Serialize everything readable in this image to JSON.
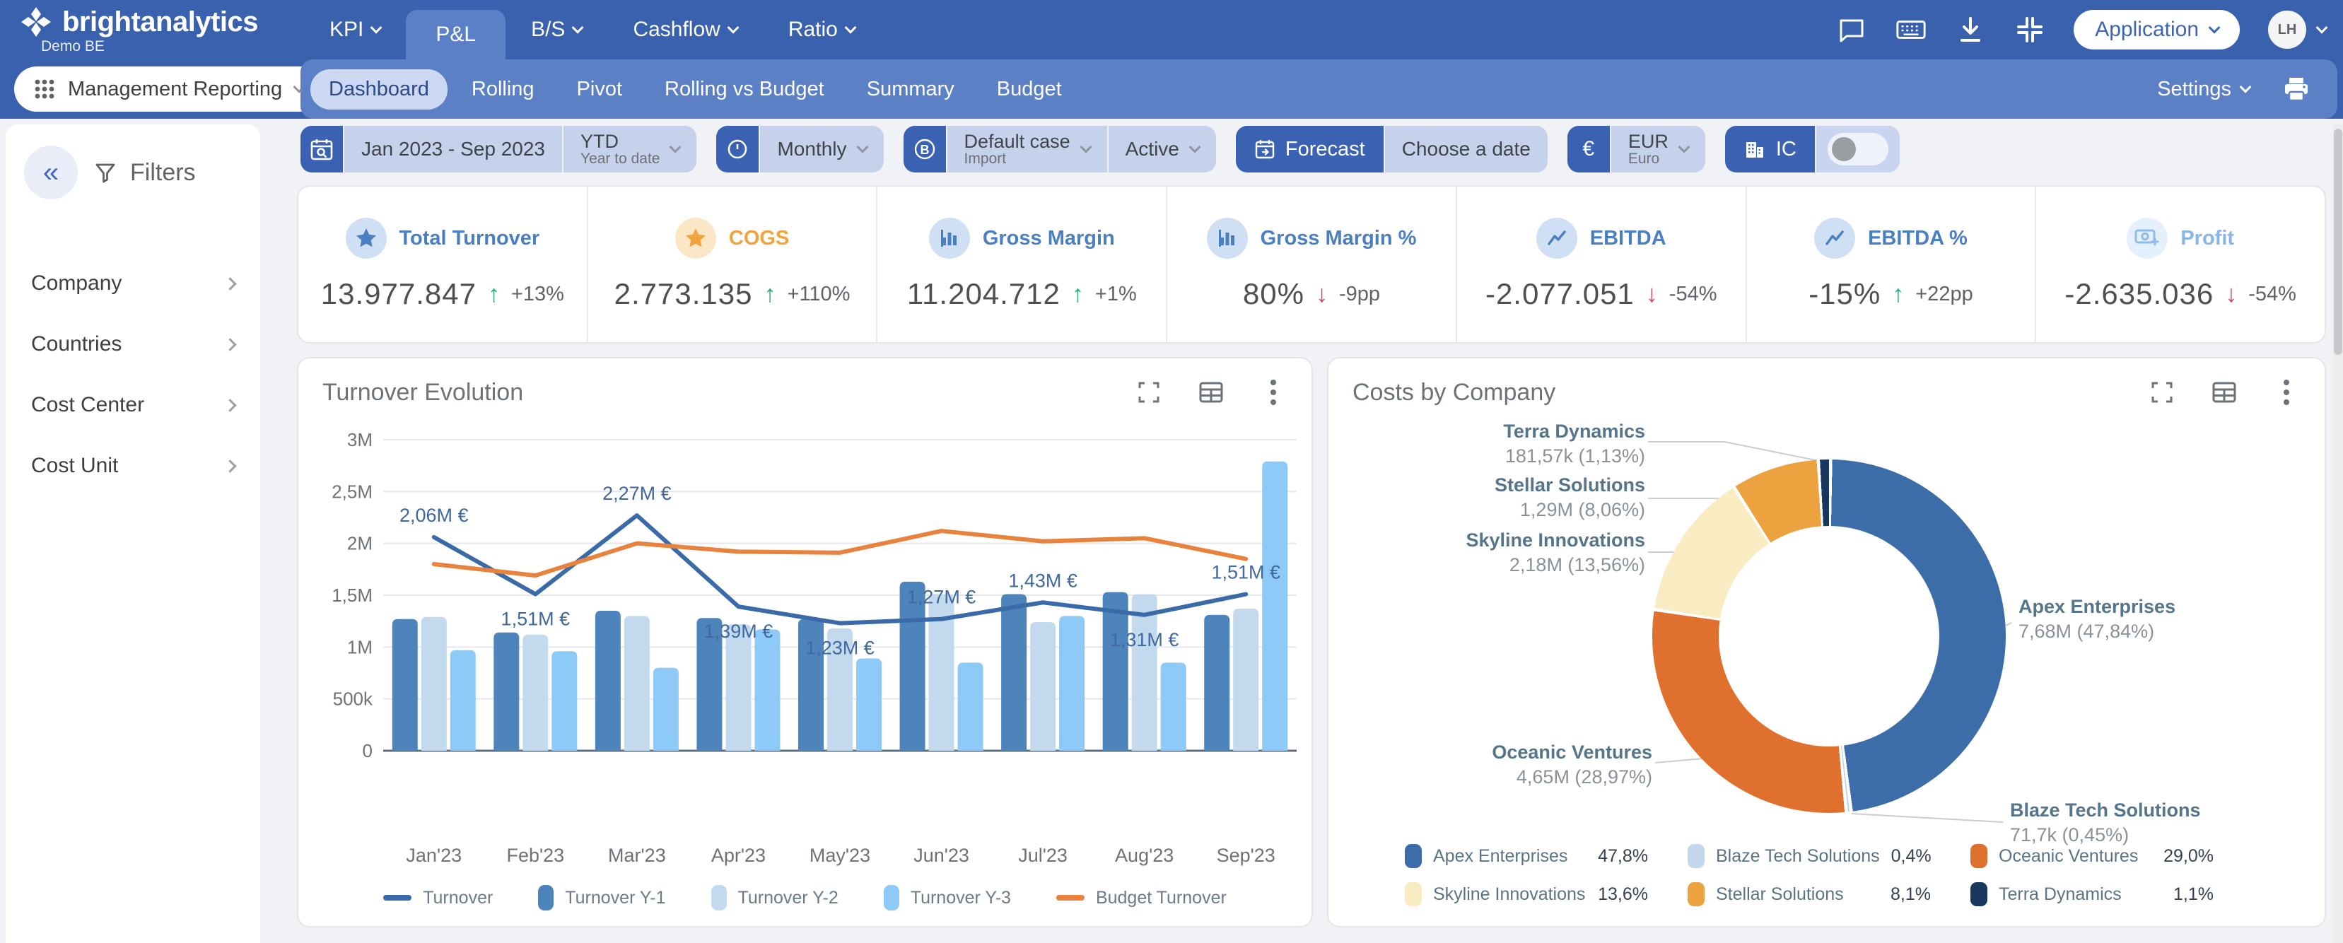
{
  "topbar": {
    "logo_text": "brightanalytics",
    "logo_sub": "Demo BE",
    "nav": [
      {
        "label": "KPI",
        "dropdown": true,
        "selected": false
      },
      {
        "label": "P&L",
        "dropdown": false,
        "selected": true
      },
      {
        "label": "B/S",
        "dropdown": true,
        "selected": false
      },
      {
        "label": "Cashflow",
        "dropdown": true,
        "selected": false
      },
      {
        "label": "Ratio",
        "dropdown": true,
        "selected": false
      }
    ],
    "application_label": "Application",
    "avatar_initials": "LH"
  },
  "subnav": {
    "workspace_label": "Management Reporting",
    "tabs": [
      "Dashboard",
      "Rolling",
      "Pivot",
      "Rolling vs Budget",
      "Summary",
      "Budget"
    ],
    "selected_tab": "Dashboard",
    "settings_label": "Settings"
  },
  "filterbar": {
    "period": {
      "value": "Jan 2023 - Sep 2023",
      "mode": "YTD",
      "mode_sub": "Year to date"
    },
    "granularity": "Monthly",
    "case": {
      "value": "Default case",
      "sub": "Import",
      "status": "Active"
    },
    "forecast_label": "Forecast",
    "choose_date_label": "Choose a date",
    "currency": {
      "symbol": "€",
      "code": "EUR",
      "name": "Euro"
    },
    "ic_label": "IC",
    "ic_enabled": false
  },
  "sidebar": {
    "title": "Filters",
    "items": [
      "Company",
      "Countries",
      "Cost Center",
      "Cost Unit"
    ]
  },
  "kpis": [
    {
      "title": "Total Turnover",
      "icon": "star",
      "title_color": "#4a7fc1",
      "ico_bg": "#cfe0f4",
      "ico_color": "#4a7fc1",
      "value": "13.977.847",
      "delta": "+13%",
      "direction": "up"
    },
    {
      "title": "COGS",
      "icon": "star",
      "title_color": "#efa440",
      "ico_bg": "#fbe6c6",
      "ico_color": "#efa440",
      "value": "2.773.135",
      "delta": "+110%",
      "direction": "up"
    },
    {
      "title": "Gross Margin",
      "icon": "bar-chart",
      "title_color": "#4a7fc1",
      "ico_bg": "#cfe0f4",
      "ico_color": "#4a7fc1",
      "value": "11.204.712",
      "delta": "+1%",
      "direction": "up"
    },
    {
      "title": "Gross Margin %",
      "icon": "bar-chart",
      "title_color": "#4a7fc1",
      "ico_bg": "#cfe0f4",
      "ico_color": "#4a7fc1",
      "value": "80%",
      "delta": "-9pp",
      "direction": "down"
    },
    {
      "title": "EBITDA",
      "icon": "line-chart",
      "title_color": "#4a7fc1",
      "ico_bg": "#cfe0f4",
      "ico_color": "#4a7fc1",
      "value": "-2.077.051",
      "delta": "-54%",
      "direction": "down"
    },
    {
      "title": "EBITDA %",
      "icon": "line-chart",
      "title_color": "#4a7fc1",
      "ico_bg": "#cfe0f4",
      "ico_color": "#4a7fc1",
      "value": "-15%",
      "delta": "+22pp",
      "direction": "up"
    },
    {
      "title": "Profit",
      "icon": "money",
      "title_color": "#86b7e8",
      "ico_bg": "#e4f0fc",
      "ico_color": "#8fbde8",
      "value": "-2.635.036",
      "delta": "-54%",
      "direction": "down"
    }
  ],
  "chart_data": [
    {
      "type": "bar",
      "title": "Turnover Evolution",
      "categories": [
        "Jan'23",
        "Feb'23",
        "Mar'23",
        "Apr'23",
        "May'23",
        "Jun'23",
        "Jul'23",
        "Aug'23",
        "Sep'23"
      ],
      "unit": "M EUR",
      "ylim": [
        0,
        3
      ],
      "yticks": [
        {
          "v": 0,
          "label": "0"
        },
        {
          "v": 0.5,
          "label": "500k"
        },
        {
          "v": 1,
          "label": "1M"
        },
        {
          "v": 1.5,
          "label": "1,5M"
        },
        {
          "v": 2,
          "label": "2M"
        },
        {
          "v": 2.5,
          "label": "2,5M"
        },
        {
          "v": 3,
          "label": "3M"
        }
      ],
      "grid": true,
      "legend_position": "bottom",
      "series": [
        {
          "name": "Turnover",
          "kind": "line",
          "color": "#3a6ba8",
          "values": [
            2.06,
            1.51,
            2.27,
            1.39,
            1.23,
            1.27,
            1.43,
            1.31,
            1.51
          ],
          "point_labels": [
            "2,06M €",
            "1,51M €",
            "2,27M €",
            "1,39M €",
            "1,23M €",
            "1,27M €",
            "1,43M €",
            "1,31M €",
            "1,51M €"
          ],
          "label_side": [
            "above",
            "below",
            "above",
            "below",
            "below",
            "above",
            "above",
            "below",
            "above"
          ]
        },
        {
          "name": "Turnover Y-1",
          "kind": "bar",
          "color": "#4d84bc",
          "values": [
            1.27,
            1.14,
            1.35,
            1.28,
            1.27,
            1.63,
            1.51,
            1.53,
            1.31
          ]
        },
        {
          "name": "Turnover Y-2",
          "kind": "bar",
          "color": "#c3d9ee",
          "values": [
            1.29,
            1.12,
            1.3,
            1.22,
            1.18,
            1.51,
            1.24,
            1.51,
            1.37
          ]
        },
        {
          "name": "Turnover Y-3",
          "kind": "bar",
          "color": "#8ecaf7",
          "values": [
            0.97,
            0.96,
            0.8,
            1.17,
            0.89,
            0.85,
            1.3,
            0.85,
            2.79
          ]
        },
        {
          "name": "Budget Turnover",
          "kind": "line",
          "color": "#e8823d",
          "values": [
            1.8,
            1.69,
            2.0,
            1.92,
            1.91,
            2.12,
            2.02,
            2.05,
            1.85
          ]
        }
      ]
    },
    {
      "type": "pie",
      "title": "Costs by Company",
      "donut": true,
      "slices": [
        {
          "name": "Apex Enterprises",
          "value_label": "7,68M",
          "pct": 47.84,
          "callout": "7,68M (47,84%)",
          "legend_pct": "47,8%",
          "color": "#3d6da8"
        },
        {
          "name": "Blaze Tech Solutions",
          "value_label": "71,7k",
          "pct": 0.45,
          "callout": "71,7k (0,45%)",
          "legend_pct": "0,4%",
          "color": "#c3d8ec"
        },
        {
          "name": "Oceanic Ventures",
          "value_label": "4,65M",
          "pct": 28.97,
          "callout": "4,65M (28,97%)",
          "legend_pct": "29,0%",
          "color": "#e0702d"
        },
        {
          "name": "Skyline Innovations",
          "value_label": "2,18M",
          "pct": 13.56,
          "callout": "2,18M (13,56%)",
          "legend_pct": "13,6%",
          "color": "#f9ecc2"
        },
        {
          "name": "Stellar Solutions",
          "value_label": "1,29M",
          "pct": 8.06,
          "callout": "1,29M (8,06%)",
          "legend_pct": "8,1%",
          "color": "#eca33f"
        },
        {
          "name": "Terra Dynamics",
          "value_label": "181,57k",
          "pct": 1.13,
          "callout": "181,57k (1,13%)",
          "legend_pct": "1,1%",
          "color": "#17375f"
        }
      ],
      "slice_order_clockwise_from_top": [
        "Apex Enterprises",
        "Blaze Tech Solutions",
        "Oceanic Ventures",
        "Skyline Innovations",
        "Stellar Solutions",
        "Terra Dynamics"
      ],
      "legend_order": [
        "Apex Enterprises",
        "Blaze Tech Solutions",
        "Oceanic Ventures",
        "Skyline Innovations",
        "Stellar Solutions",
        "Terra Dynamics"
      ]
    }
  ]
}
